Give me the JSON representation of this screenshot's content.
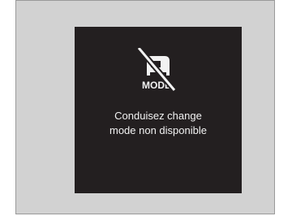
{
  "screen": {
    "icon": "mode-unavailable-icon",
    "icon_label": "MODE",
    "message_line1": "Conduisez change",
    "message_line2": "mode non disponible"
  },
  "colors": {
    "screen_background": "#231f20",
    "panel_background": "#d2d2d2",
    "text": "#f2f2f2"
  }
}
